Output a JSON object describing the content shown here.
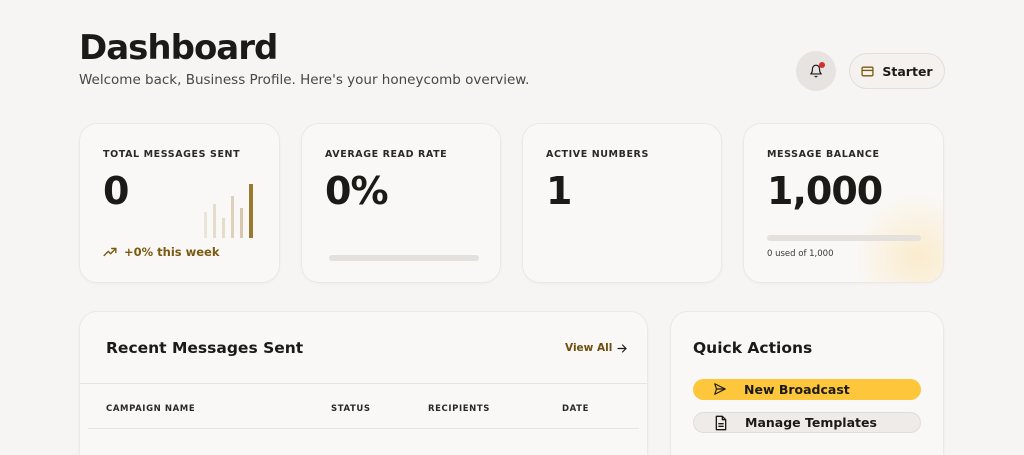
{
  "header": {
    "title": "Dashboard",
    "subtitle": "Welcome back, Business Profile. Here's your honeycomb overview.",
    "plan_label": "Starter"
  },
  "stats": [
    {
      "label": "TOTAL MESSAGES SENT",
      "value": "0",
      "trend": "+0% this week"
    },
    {
      "label": "AVERAGE READ RATE",
      "value": "0%",
      "progress": 0
    },
    {
      "label": "ACTIVE NUMBERS",
      "value": "1"
    },
    {
      "label": "MESSAGE BALANCE",
      "value": "1,000",
      "note": "0 used of 1,000",
      "progress": 0
    }
  ],
  "recent": {
    "title": "Recent Messages Sent",
    "view_all": "View All",
    "columns": [
      "CAMPAIGN NAME",
      "STATUS",
      "RECIPIENTS",
      "DATE"
    ]
  },
  "quick_actions": {
    "title": "Quick Actions",
    "items": [
      {
        "label": "New Broadcast",
        "icon": "send-icon"
      },
      {
        "label": "Manage Templates",
        "icon": "document-icon"
      }
    ]
  },
  "colors": {
    "accent": "#fec63a",
    "accent_text": "#7a5a10",
    "notification_dot": "#d32f2f",
    "background": "#f7f5f3"
  }
}
